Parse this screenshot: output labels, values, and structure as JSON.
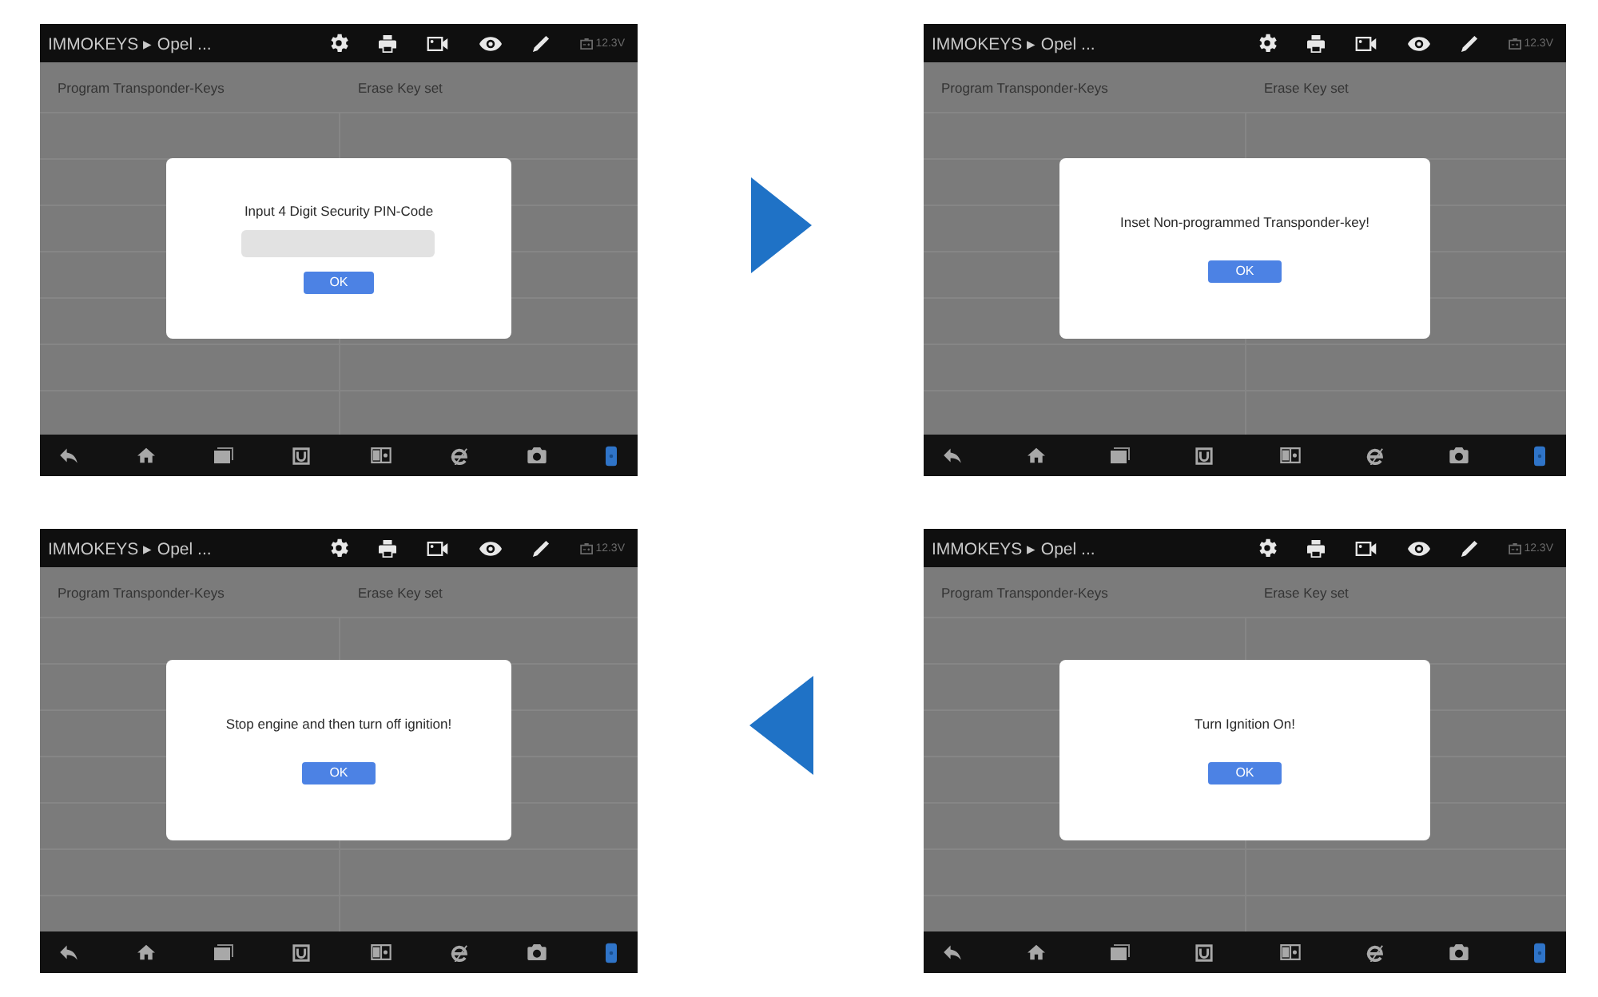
{
  "screens": [
    {
      "header": {
        "breadcrumb": "IMMOKEYS ▸ Opel ...",
        "battery_voltage": "12.3V"
      },
      "functions": [
        "Program Transponder-Keys",
        "Erase Key set"
      ],
      "dialog": {
        "kind": "pin_entry",
        "message": "Input 4 Digit Security PIN-Code",
        "button": "OK"
      }
    },
    {
      "header": {
        "breadcrumb": "IMMOKEYS ▸ Opel ...",
        "battery_voltage": "12.3V"
      },
      "functions": [
        "Program Transponder-Keys",
        "Erase Key set"
      ],
      "dialog": {
        "kind": "notice",
        "message": "Inset Non-programmed Transponder-key!",
        "button": "OK"
      }
    },
    {
      "header": {
        "breadcrumb": "IMMOKEYS ▸ Opel ...",
        "battery_voltage": "12.3V"
      },
      "functions": [
        "Program Transponder-Keys",
        "Erase Key set"
      ],
      "dialog": {
        "kind": "notice",
        "message": "Stop engine and then turn off ignition!",
        "button": "OK"
      }
    },
    {
      "header": {
        "breadcrumb": "IMMOKEYS ▸ Opel ...",
        "battery_voltage": "12.3V"
      },
      "functions": [
        "Program Transponder-Keys",
        "Erase Key set"
      ],
      "dialog": {
        "kind": "notice",
        "message": "Turn Ignition On!",
        "button": "OK"
      }
    }
  ]
}
